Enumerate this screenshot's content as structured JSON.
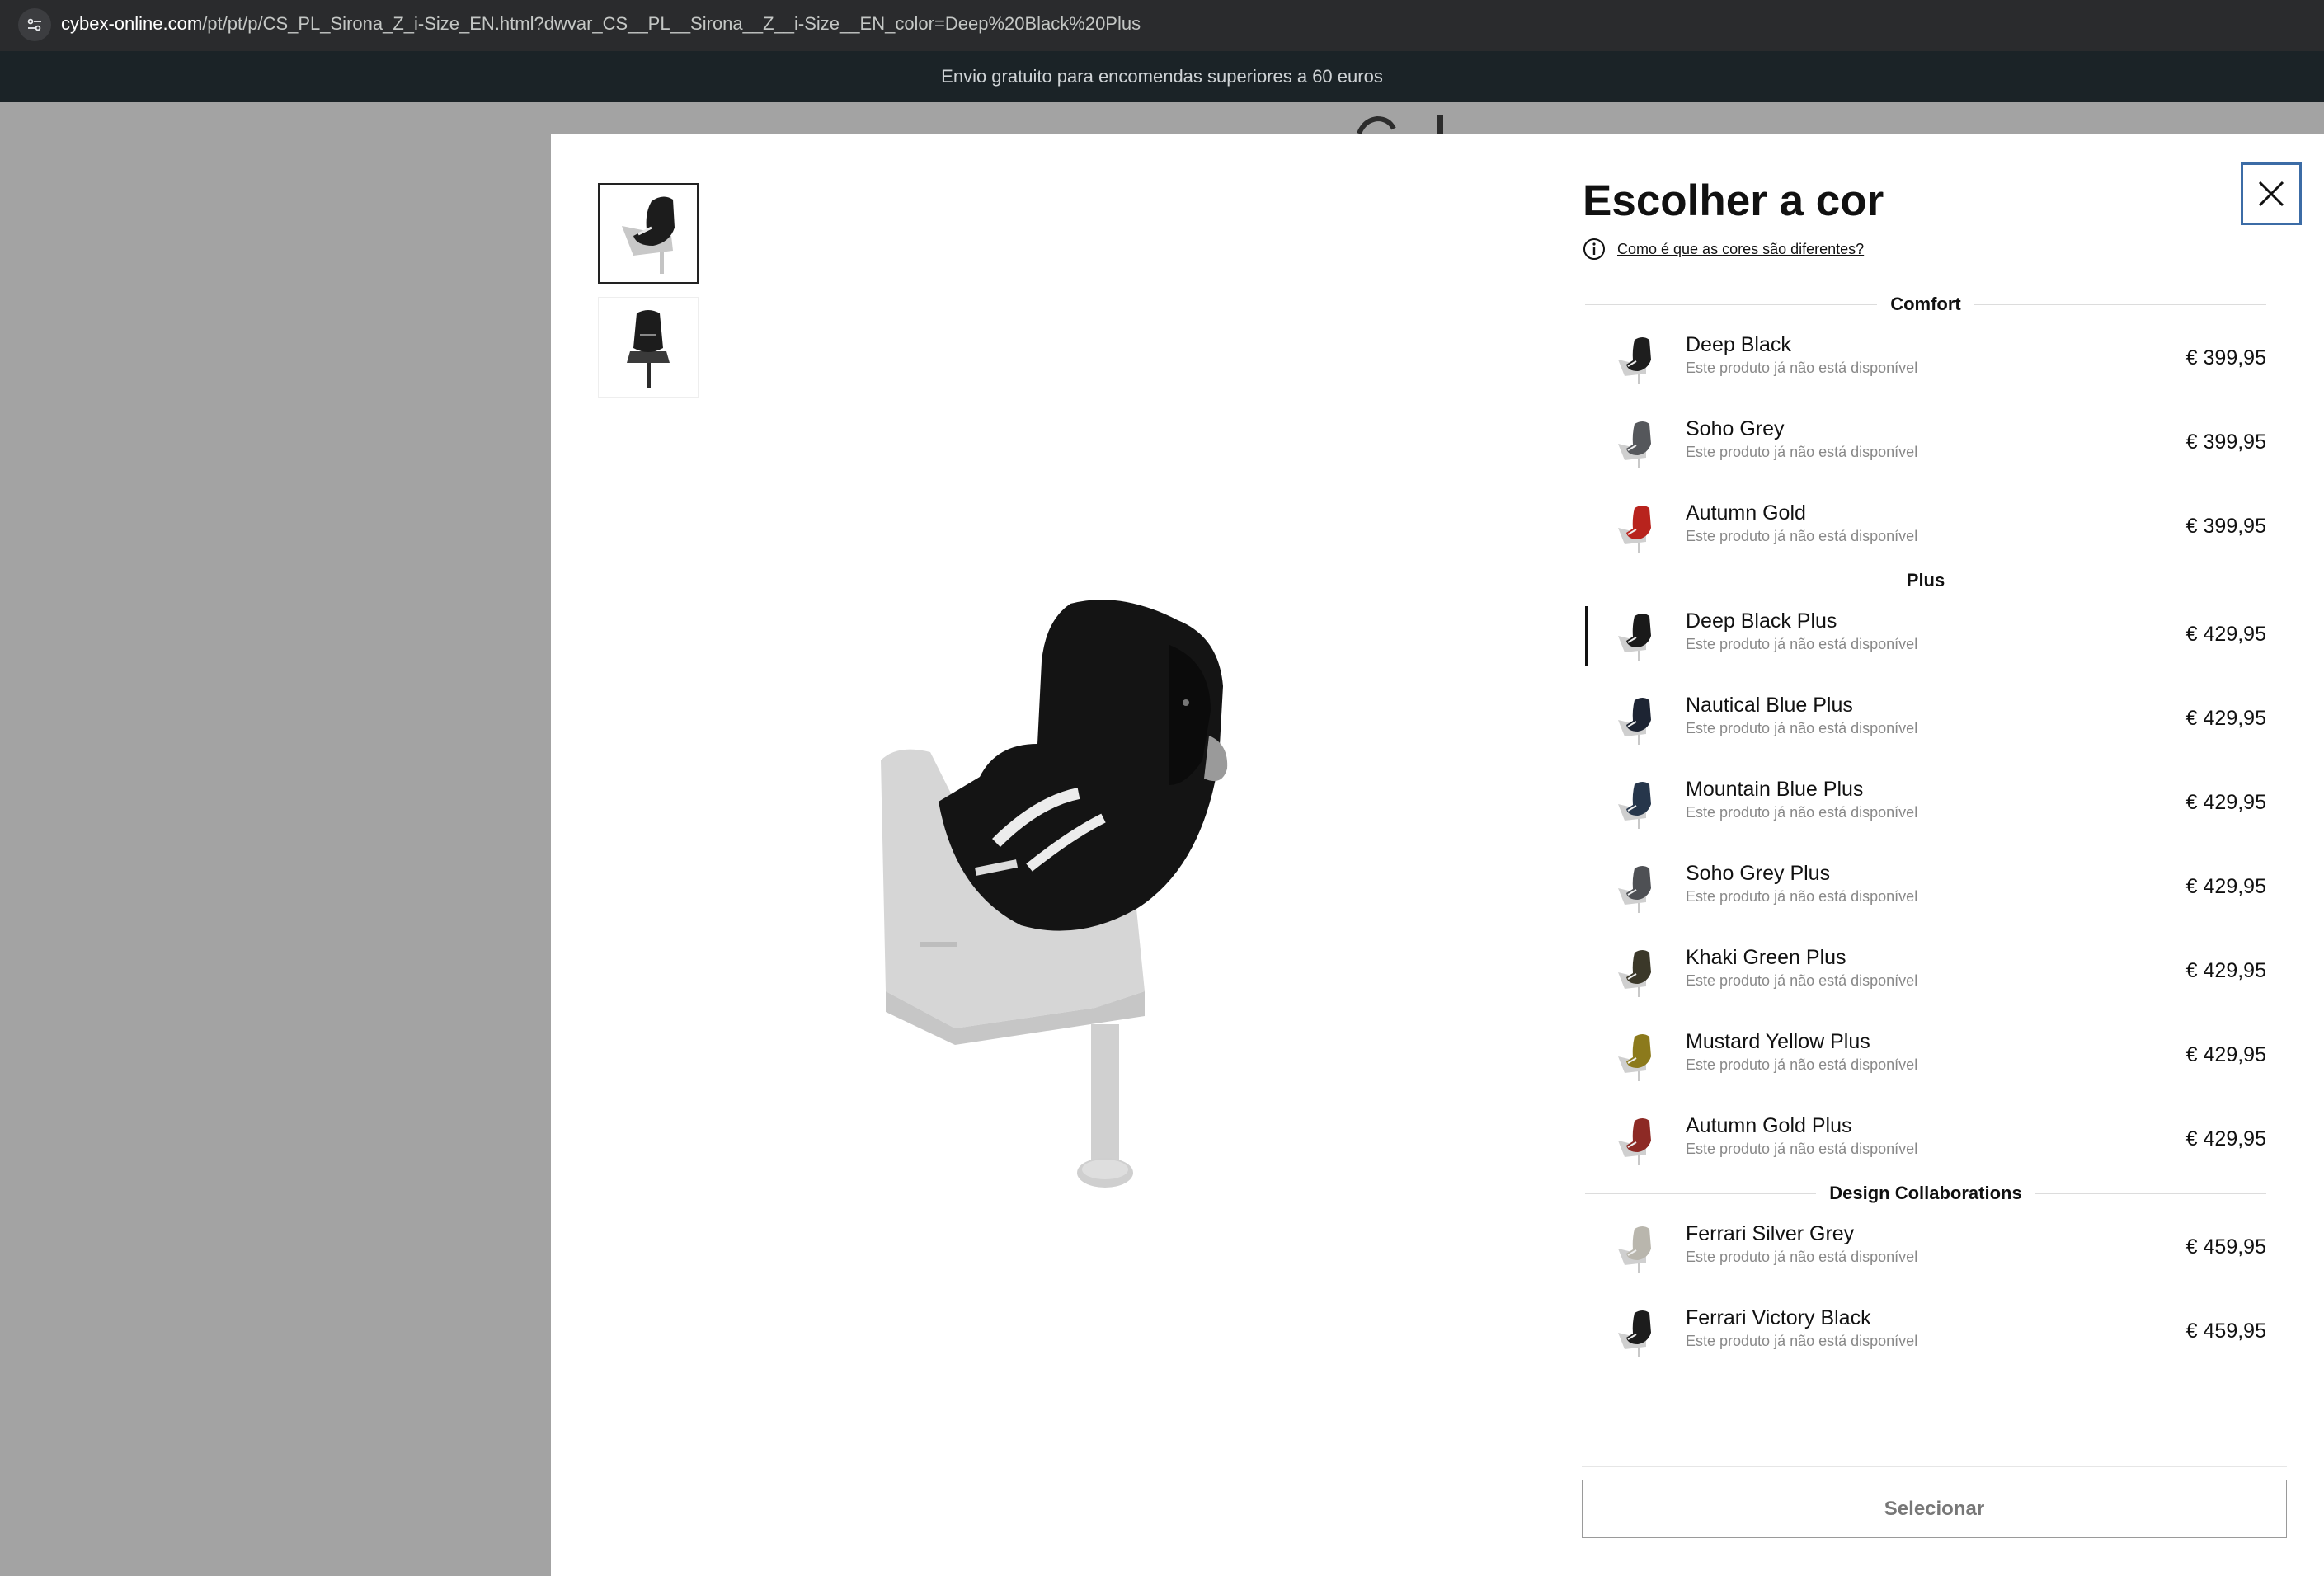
{
  "browser": {
    "url_domain": "cybex-online.com",
    "url_path": "/pt/pt/p/CS_PL_Sirona_Z_i-Size_EN.html?dwvar_CS__PL__Sirona__Z__i-Size__EN_color=Deep%20Black%20Plus"
  },
  "promo_banner": "Envio gratuito para encomendas superiores a 60 euros",
  "modal": {
    "title": "Escolher a cor",
    "info_link": "Como é que as cores são diferentes?",
    "select_button": "Selecionar",
    "thumbnails": [
      {
        "icon": "car-seat-side-view",
        "active": true
      },
      {
        "icon": "car-seat-front-view",
        "active": false
      }
    ],
    "groups": [
      {
        "label": "Comfort",
        "options": [
          {
            "name": "Deep Black",
            "note": "Este produto já não está disponível",
            "price": "€ 399,95",
            "color": "#1e1e1e",
            "selected": false
          },
          {
            "name": "Soho Grey",
            "note": "Este produto já não está disponível",
            "price": "€ 399,95",
            "color": "#55575b",
            "selected": false
          },
          {
            "name": "Autumn Gold",
            "note": "Este produto já não está disponível",
            "price": "€ 399,95",
            "color": "#b8231d",
            "selected": false
          }
        ]
      },
      {
        "label": "Plus",
        "options": [
          {
            "name": "Deep Black Plus",
            "note": "Este produto já não está disponível",
            "price": "€ 429,95",
            "color": "#1a1a1a",
            "selected": true
          },
          {
            "name": "Nautical Blue Plus",
            "note": "Este produto já não está disponível",
            "price": "€ 429,95",
            "color": "#1d2433",
            "selected": false
          },
          {
            "name": "Mountain Blue Plus",
            "note": "Este produto já não está disponível",
            "price": "€ 429,95",
            "color": "#26364b",
            "selected": false
          },
          {
            "name": "Soho Grey Plus",
            "note": "Este produto já não está disponível",
            "price": "€ 429,95",
            "color": "#4e5054",
            "selected": false
          },
          {
            "name": "Khaki Green Plus",
            "note": "Este produto já não está disponível",
            "price": "€ 429,95",
            "color": "#3b3829",
            "selected": false
          },
          {
            "name": "Mustard Yellow Plus",
            "note": "Este produto já não está disponível",
            "price": "€ 429,95",
            "color": "#8c7a1c",
            "selected": false
          },
          {
            "name": "Autumn Gold Plus",
            "note": "Este produto já não está disponível",
            "price": "€ 429,95",
            "color": "#8d2a25",
            "selected": false
          }
        ]
      },
      {
        "label": "Design Collaborations",
        "options": [
          {
            "name": "Ferrari Silver Grey",
            "note": "Este produto já não está disponível",
            "price": "€ 459,95",
            "color": "#b9b6ad",
            "selected": false
          },
          {
            "name": "Ferrari Victory Black",
            "note": "Este produto já não está disponível",
            "price": "€ 459,95",
            "color": "#1c1c1c",
            "selected": false
          }
        ]
      }
    ]
  }
}
